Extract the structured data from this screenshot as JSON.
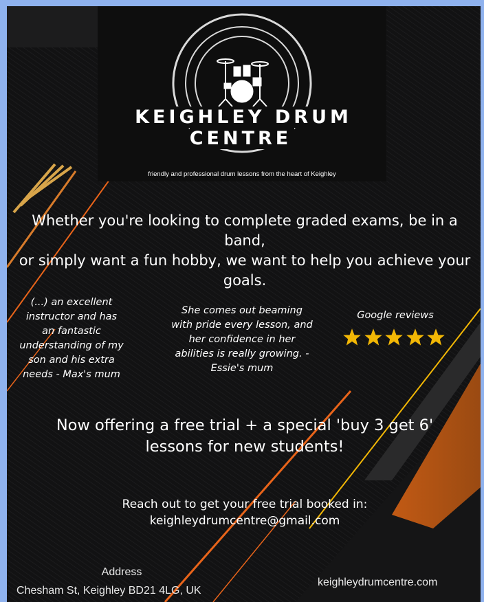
{
  "logo": {
    "brand_name": "KEIGHLEY DRUM CENTRE",
    "tagline": "friendly and professional drum lessons from the heart of Keighley",
    "icon": "drum-kit-icon"
  },
  "intro": {
    "line1": "Whether you're looking to complete graded exams, be in a band,",
    "line2": "or simply want a fun hobby, we want to help you achieve your",
    "line3": "goals."
  },
  "testimonials": [
    {
      "lines": [
        "(...) an excellent",
        "instructor and has",
        "an fantastic",
        "understanding of my",
        "son and his extra",
        "needs - Max's mum"
      ]
    },
    {
      "lines": [
        "She comes out beaming",
        "with pride every lesson, and",
        "her confidence in her",
        "abilities is really growing. -",
        "Essie's mum"
      ]
    }
  ],
  "reviews": {
    "label": "Google reviews",
    "rating": 5,
    "rating_max": 5,
    "star_color": "#f2b705",
    "icon": "star-icon"
  },
  "offer": {
    "line1": "Now offering a free trial + a special 'buy 3 get 6'",
    "line2": "lessons for new students!"
  },
  "contact": {
    "reach_line": "Reach out to get your free trial booked in:",
    "email": "keighleydrumcentre@gmail.com"
  },
  "footer": {
    "address_label": "Address",
    "address": "Chesham St, Keighley BD21 4LG, UK",
    "website": "keighleydrumcentre.com"
  },
  "colors": {
    "background": "#101011",
    "frame": "#8fb2ee",
    "accent_orange": "#e8641a",
    "accent_yellow": "#f2b705",
    "text": "#ffffff"
  }
}
